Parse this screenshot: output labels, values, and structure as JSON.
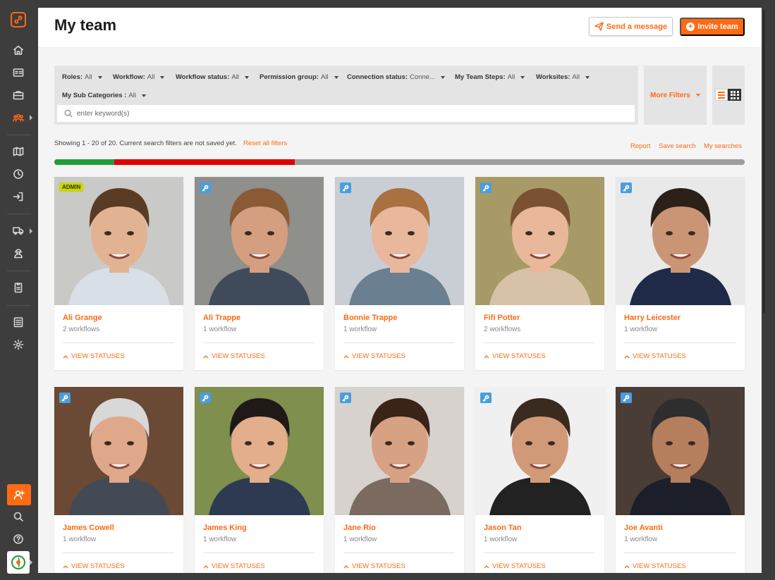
{
  "sidebar": {
    "logo": "link-logo-icon",
    "items": [
      {
        "icon": "home-icon"
      },
      {
        "icon": "id-card-icon"
      },
      {
        "icon": "briefcase-icon"
      },
      {
        "icon": "team-icon",
        "active": true
      },
      {
        "icon": "map-icon"
      },
      {
        "icon": "clock-icon"
      },
      {
        "icon": "sign-in-icon"
      },
      {
        "icon": "truck-icon"
      },
      {
        "icon": "worker-icon"
      },
      {
        "icon": "badge-icon"
      },
      {
        "icon": "checklist-icon"
      },
      {
        "icon": "gear-icon"
      },
      {
        "icon": "add-user-icon"
      },
      {
        "icon": "search-icon"
      },
      {
        "icon": "help-icon"
      }
    ]
  },
  "header": {
    "title": "My team",
    "send_message": "Send a message",
    "invite_team": "Invite team"
  },
  "filters": [
    {
      "label": "Roles:",
      "value": "All"
    },
    {
      "label": "Workflow:",
      "value": "All"
    },
    {
      "label": "Workflow status:",
      "value": "All"
    },
    {
      "label": "Permission group:",
      "value": "All"
    },
    {
      "label": "Connection status:",
      "value": "Conne..."
    },
    {
      "label": "My Team Steps:",
      "value": "All"
    },
    {
      "label": "Worksites:",
      "value": "All"
    },
    {
      "label": "My Sub Categories :",
      "value": "All"
    }
  ],
  "search": {
    "placeholder": "enter keyword(s)",
    "value": ""
  },
  "more_filters": "More Filters",
  "results": {
    "summary": "Showing 1 - 20 of 20. Current search filters are not saved yet.",
    "reset": "Reset all filters",
    "report": "Report",
    "save_search": "Save search",
    "my_searches": "My searches"
  },
  "status_bar": {
    "segments": [
      {
        "fraction": 0.087,
        "color": "#1f9d3a"
      },
      {
        "fraction": 0.261,
        "color": "#e00000"
      },
      {
        "fraction": 0.652,
        "color": "#9e9e9e"
      }
    ]
  },
  "colors": {
    "accent": "#ff6a13",
    "key_badge": "#4a9ee0",
    "admin_badge": "#c6d800"
  },
  "view_statuses_label": "VIEW STATUSES",
  "members": [
    {
      "name": "Ali Grange",
      "workflows": "2 workflows",
      "badge": "ADMIN",
      "bg": "#c9c9c7",
      "skin": "#e2b393",
      "hair": "#5a3b24",
      "shirt": "#d9dfe6"
    },
    {
      "name": "Ali Trappe",
      "workflows": "1 workflow",
      "badge": "key",
      "bg": "#8f8f8b",
      "skin": "#d49e80",
      "hair": "#8a5a34",
      "shirt": "#3f4a5a"
    },
    {
      "name": "Bonnie Trappe",
      "workflows": "1 workflow",
      "badge": "key",
      "bg": "#c9ced4",
      "skin": "#e8b79c",
      "hair": "#a8713f",
      "shirt": "#6a7f8f"
    },
    {
      "name": "Fifi Potter",
      "workflows": "2 workflows",
      "badge": "key",
      "bg": "#a89a66",
      "skin": "#e9b89b",
      "hair": "#7a5233",
      "shirt": "#d7c2a8"
    },
    {
      "name": "Harry Leicester",
      "workflows": "1 workflow",
      "badge": "key",
      "bg": "#e9e9e9",
      "skin": "#c99574",
      "hair": "#2b2119",
      "shirt": "#1e2a47"
    },
    {
      "name": "James Cowell",
      "workflows": "1 workflow",
      "badge": "key",
      "bg": "#6a4a34",
      "skin": "#e0a88b",
      "hair": "#d8d8d8",
      "shirt": "#444a55"
    },
    {
      "name": "James King",
      "workflows": "1 workflow",
      "badge": "key",
      "bg": "#7e8f4e",
      "skin": "#e2ae8c",
      "hair": "#1f1a17",
      "shirt": "#2e3a52"
    },
    {
      "name": "Jane Rio",
      "workflows": "1 workflow",
      "badge": "key",
      "bg": "#d7d2cd",
      "skin": "#d7a184",
      "hair": "#3a2418",
      "shirt": "#7a6a60"
    },
    {
      "name": "Jason Tan",
      "workflows": "1 workflow",
      "badge": "key",
      "bg": "#f0f0f0",
      "skin": "#d09a78",
      "hair": "#3b2a1f",
      "shirt": "#222222"
    },
    {
      "name": "Joe Avanti",
      "workflows": "1 workflow",
      "badge": "key",
      "bg": "#4a3d36",
      "skin": "#b57f5d",
      "hair": "#2e2e2e",
      "shirt": "#1c1f2a"
    }
  ]
}
